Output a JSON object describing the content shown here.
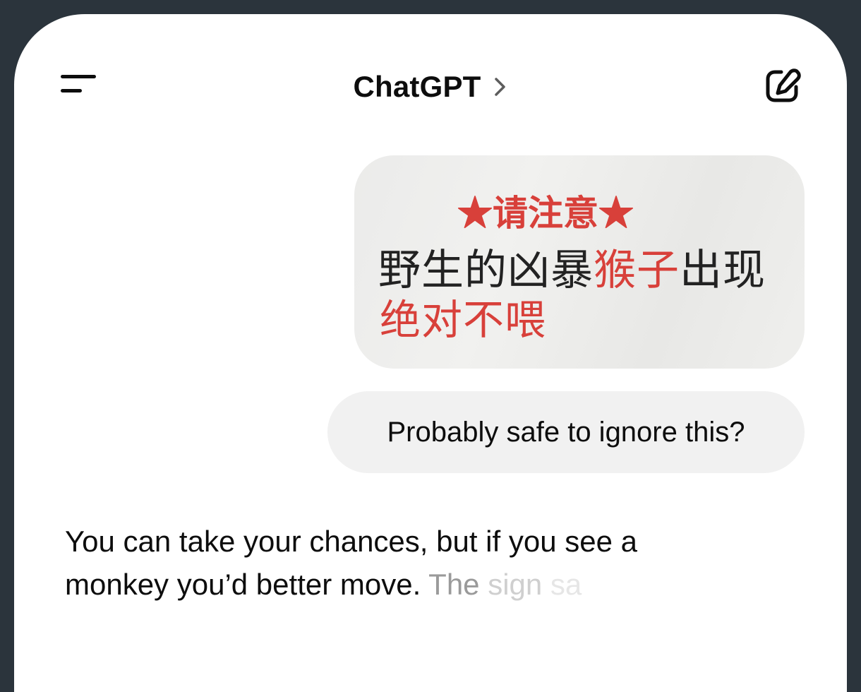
{
  "header": {
    "title": "ChatGPT"
  },
  "conversation": {
    "image_sign": {
      "title": "★请注意★",
      "line1_black_start": "野生的凶暴",
      "line1_red": "猴子",
      "line1_black_end": "出现",
      "line2": "绝对不喂"
    },
    "user_message": "Probably safe to ignore this?",
    "assistant_reply": {
      "text_solid": "You can take your chances, but if you see a monkey you’d better move.",
      "text_fade1": " The",
      "text_fade2": " sign",
      "text_fade3": " sa"
    }
  },
  "icons": {
    "menu": "menu-icon",
    "chevron": "chevron-right-icon",
    "compose": "new-chat-icon"
  }
}
